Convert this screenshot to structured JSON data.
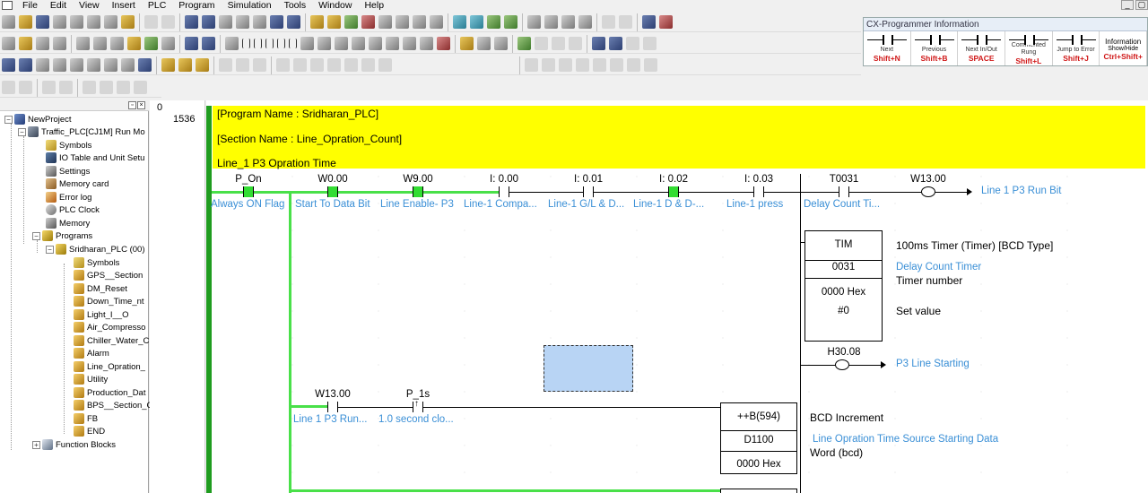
{
  "menu": [
    "File",
    "Edit",
    "View",
    "Insert",
    "PLC",
    "Program",
    "Simulation",
    "Tools",
    "Window",
    "Help"
  ],
  "mdi_controls": [
    "_",
    "▢"
  ],
  "info_panel": {
    "title": "CX-Programmer Information",
    "cells": [
      {
        "title": "Next",
        "key": "Shift+N"
      },
      {
        "title": "Previous",
        "key": "Shift+B"
      },
      {
        "title": "Next In/Out",
        "key": "SPACE"
      },
      {
        "title": "Commented Rung",
        "key": "Shift+L"
      },
      {
        "title": "Jump to Error",
        "key": "Shift+J"
      }
    ],
    "last": {
      "t1": "Information",
      "t2": "Show/Hide",
      "k": "Ctrl+Shift+"
    }
  },
  "tree": {
    "root": "NewProject",
    "plc": "Traffic_PLC[CJ1M] Run Mo",
    "items": [
      "Symbols",
      "IO Table and Unit Setu",
      "Settings",
      "Memory card",
      "Error log",
      "PLC Clock",
      "Memory",
      "Programs"
    ],
    "program": "Sridharan_PLC (00)",
    "sections": [
      "Symbols",
      "GPS__Section",
      "DM_Reset",
      "Down_Time_nt",
      "Light_I__O",
      "Air_Compresso",
      "Chiller_Water_C",
      "Alarm",
      "Line_Opration_",
      "Utility",
      "Production_Dat",
      "BPS__Section_C",
      "FB",
      "END"
    ],
    "function_blocks": "Function Blocks"
  },
  "rung": {
    "number": "0",
    "step": "1536"
  },
  "comment_lines": [
    "[Program Name : Sridharan_PLC]",
    "[Section Name : Line_Opration_Count]",
    "Line_1 P3  Opration  Time"
  ],
  "contacts_row1": [
    {
      "op": "P_On",
      "cmt": "Always ON Flag"
    },
    {
      "op": "W0.00",
      "cmt": "Start To Data Bit"
    },
    {
      "op": "W9.00",
      "cmt": "Line Enable- P3"
    },
    {
      "op": "I: 0.00",
      "cmt": "Line-1  Compa..."
    },
    {
      "op": "I: 0.01",
      "cmt": "Line-1 G/L & D..."
    },
    {
      "op": "I: 0.02",
      "cmt": "Line-1  D & D-..."
    },
    {
      "op": "I: 0.03",
      "cmt": "Line-1 press"
    },
    {
      "op": "T0031",
      "cmt": "Delay Count Ti..."
    }
  ],
  "coil_run": {
    "op": "W13.00",
    "cmt": "Line 1 P3  Run Bit"
  },
  "timer": {
    "name": "TIM",
    "desc": "100ms Timer (Timer) [BCD Type]",
    "num": "0031",
    "num_cmt": "Delay Count Timer",
    "num_label": "Timer number",
    "set_hex": "0000 Hex",
    "set_val": "#0",
    "set_label": "Set value"
  },
  "coil_start": {
    "op": "H30.08",
    "cmt": "P3 Line Starting"
  },
  "contacts_row2": [
    {
      "op": "W13.00",
      "cmt": "Line 1 P3  Run..."
    },
    {
      "op": "P_1s",
      "cmt": "1.0 second clo..."
    }
  ],
  "bcd": {
    "name": "++B(594)",
    "desc": "BCD Increment",
    "operand": "D1100",
    "operand_cmt": "Line Opration Time Source  Starting Data",
    "operand_label": "Word (bcd)",
    "hex": "0000 Hex"
  }
}
